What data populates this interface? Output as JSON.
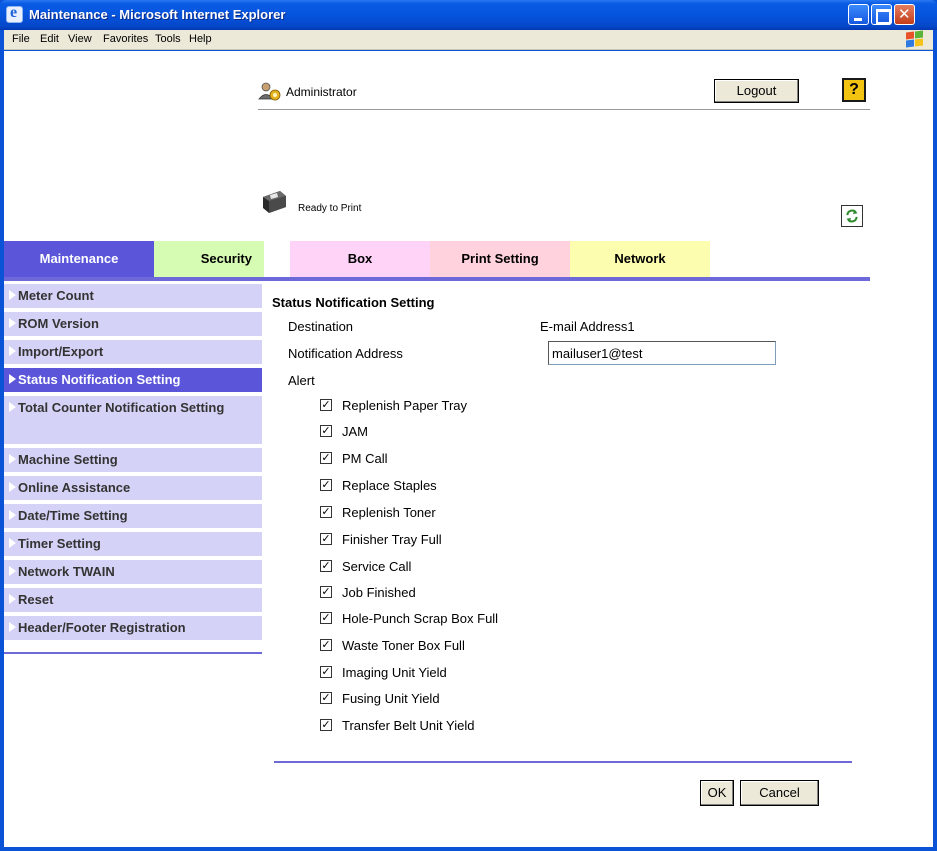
{
  "window": {
    "title": "Maintenance - Microsoft Internet Explorer",
    "menu": [
      "File",
      "Edit",
      "View",
      "Favorites",
      "Tools",
      "Help"
    ]
  },
  "header": {
    "user": "Administrator",
    "logout": "Logout",
    "help": "?",
    "status": "Ready to Print"
  },
  "tabs": [
    "Maintenance",
    "Security",
    "Box",
    "Print Setting",
    "Network"
  ],
  "sidebar": {
    "items": [
      "Meter Count",
      "ROM Version",
      "Import/Export",
      "Status Notification Setting",
      "Total Counter Notification Setting",
      "Machine Setting",
      "Online Assistance",
      "Date/Time Setting",
      "Timer Setting",
      "Network TWAIN",
      "Reset",
      "Header/Footer Registration"
    ],
    "active_index": 3
  },
  "form": {
    "title": "Status Notification Setting",
    "destination_label": "Destination",
    "destination_value": "E-mail Address1",
    "address_label": "Notification Address",
    "address_value": "mailuser1@test",
    "alert_label": "Alert",
    "alerts": [
      {
        "label": "Replenish Paper Tray",
        "checked": true
      },
      {
        "label": "JAM",
        "checked": true
      },
      {
        "label": "PM Call",
        "checked": true
      },
      {
        "label": "Replace Staples",
        "checked": true
      },
      {
        "label": "Replenish Toner",
        "checked": true
      },
      {
        "label": "Finisher Tray Full",
        "checked": true
      },
      {
        "label": "Service Call",
        "checked": true
      },
      {
        "label": "Job Finished",
        "checked": true
      },
      {
        "label": "Hole-Punch Scrap Box Full",
        "checked": true
      },
      {
        "label": "Waste Toner Box Full",
        "checked": true
      },
      {
        "label": "Imaging Unit Yield",
        "checked": true
      },
      {
        "label": "Fusing Unit Yield",
        "checked": true
      },
      {
        "label": "Transfer Belt Unit Yield",
        "checked": true
      }
    ],
    "ok": "OK",
    "cancel": "Cancel"
  }
}
